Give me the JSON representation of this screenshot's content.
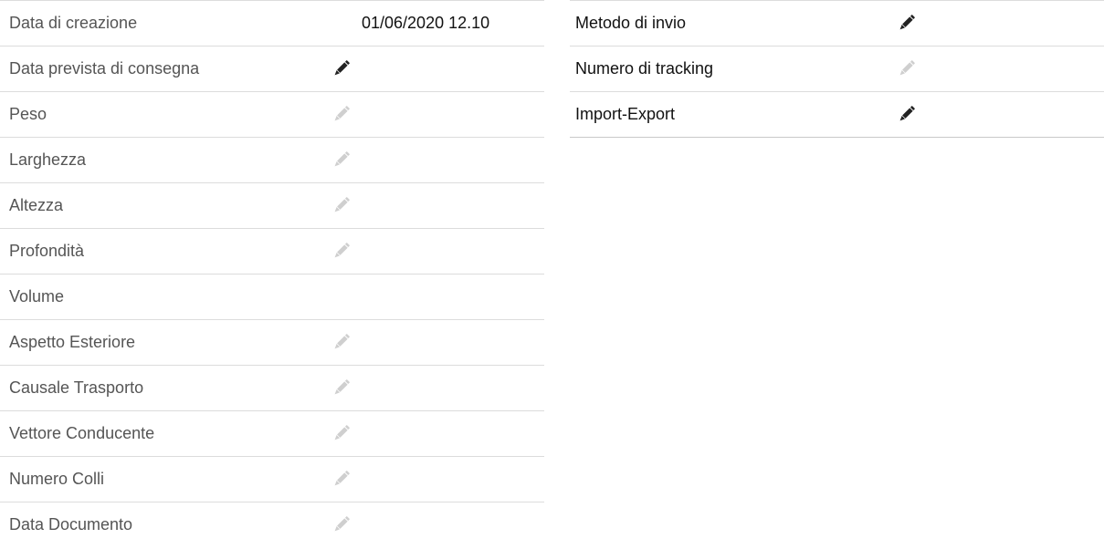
{
  "colors": {
    "pencil_active": "#222222",
    "pencil_inactive": "#cfcfcf",
    "label_left": "#555555",
    "label_right": "#111111",
    "divider": "#dcdcdc"
  },
  "left_panel": {
    "rows": [
      {
        "label": "Data di creazione",
        "value": "01/06/2020 12.10",
        "edit": "none"
      },
      {
        "label": "Data prevista di consegna",
        "value": "",
        "edit": "active"
      },
      {
        "label": "Peso",
        "value": "",
        "edit": "inactive"
      },
      {
        "label": "Larghezza",
        "value": "",
        "edit": "inactive"
      },
      {
        "label": "Altezza",
        "value": "",
        "edit": "inactive"
      },
      {
        "label": "Profondità",
        "value": "",
        "edit": "inactive"
      },
      {
        "label": "Volume",
        "value": "",
        "edit": "none"
      },
      {
        "label": "Aspetto Esteriore",
        "value": "",
        "edit": "inactive"
      },
      {
        "label": "Causale Trasporto",
        "value": "",
        "edit": "inactive"
      },
      {
        "label": "Vettore Conducente",
        "value": "",
        "edit": "inactive"
      },
      {
        "label": "Numero Colli",
        "value": "",
        "edit": "inactive"
      },
      {
        "label": "Data Documento",
        "value": "",
        "edit": "inactive"
      }
    ]
  },
  "right_panel": {
    "rows": [
      {
        "label": "Metodo di invio",
        "edit": "active"
      },
      {
        "label": "Numero di tracking",
        "edit": "inactive"
      },
      {
        "label": "Import-Export",
        "edit": "active"
      }
    ]
  },
  "icons": {
    "edit": "pencil-icon"
  }
}
